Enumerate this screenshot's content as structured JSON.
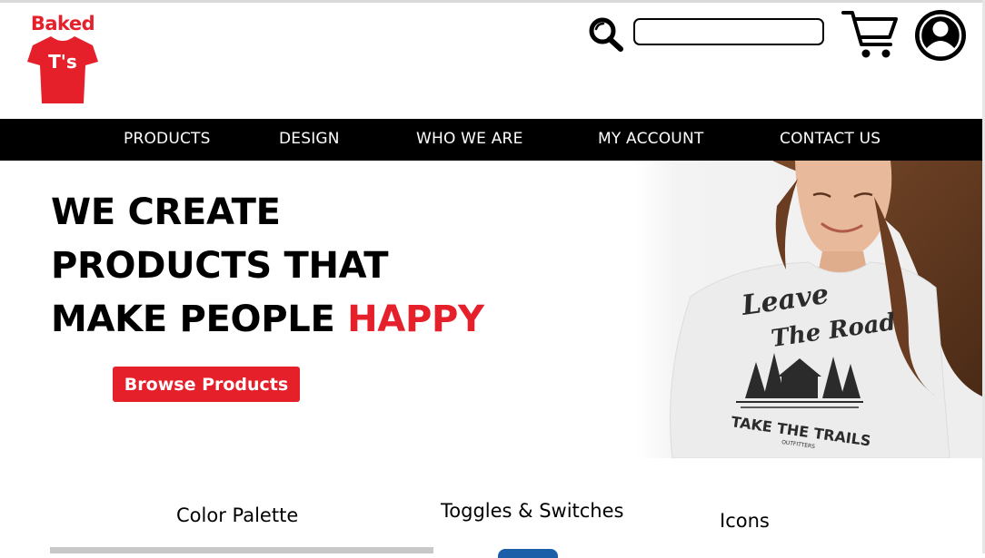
{
  "brand": {
    "logo_top": "Baked",
    "logo_shirt": "T's",
    "accent_color": "#e5202b"
  },
  "header": {
    "search": {
      "icon": "search-icon",
      "value": "",
      "placeholder": ""
    },
    "cart_icon": "cart-icon",
    "account_icon": "user-avatar-icon"
  },
  "nav": {
    "items": [
      {
        "label": "PRODUCTS"
      },
      {
        "label": "DESIGN"
      },
      {
        "label": "WHO WE ARE"
      },
      {
        "label": "MY ACCOUNT"
      },
      {
        "label": "CONTACT US"
      }
    ]
  },
  "hero": {
    "line1": "WE CREATE",
    "line2": "PRODUCTS THAT",
    "line3_prefix": "MAKE PEOPLE",
    "line3_accent": "HAPPY",
    "button_label": "Browse Products",
    "shirt_graphic": {
      "line1": "Leave",
      "line2": "The Road",
      "tagline": "TAKE THE TRAILS",
      "maker": "OUTFITTERS"
    }
  },
  "sections": {
    "color_palette": "Color Palette",
    "toggles": "Toggles  & Switches",
    "icons": "Icons"
  }
}
